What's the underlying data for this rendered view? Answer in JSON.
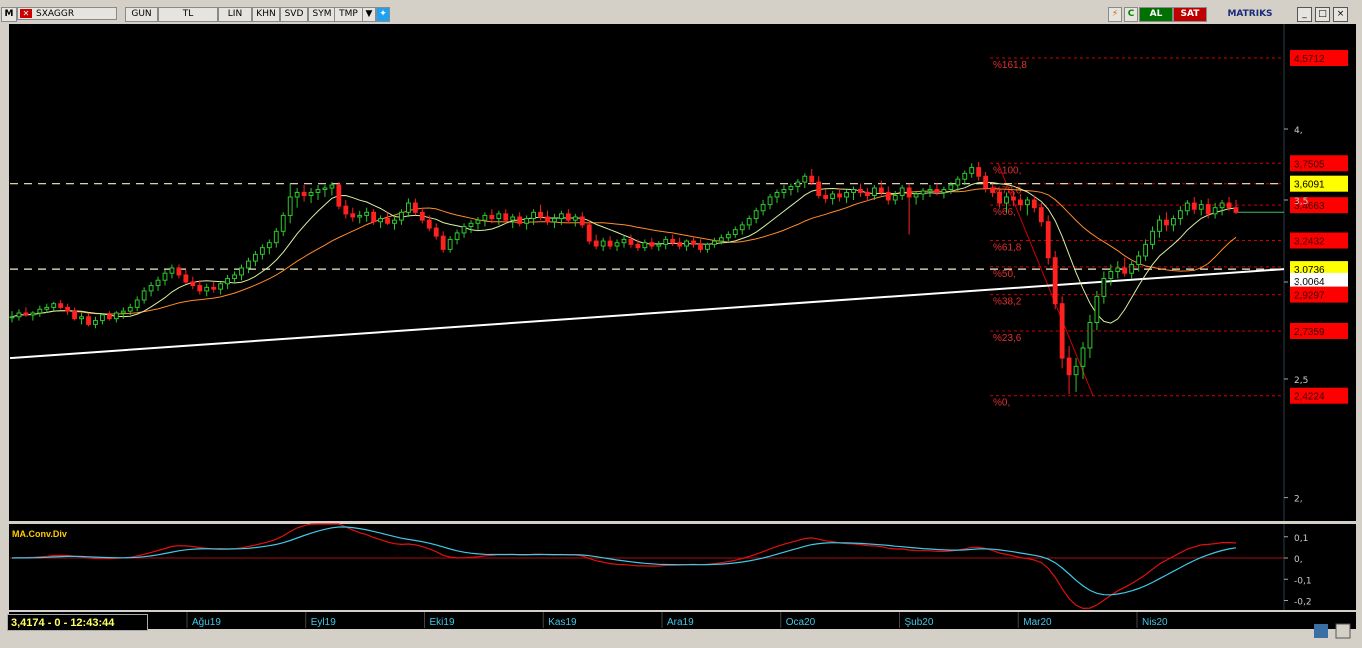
{
  "toolbar": {
    "symbol": "SXAGGR",
    "buttons": [
      "GUN",
      "TL",
      "LIN",
      "KHN",
      "SVD",
      "SYM",
      "TMP"
    ],
    "al_label": "AL",
    "sat_label": "SAT",
    "brand": "MATRIKS",
    "min_label": "_",
    "max_label": "□",
    "close_label": "×"
  },
  "status": "3,4174 - 0 - 12:43:44",
  "chart_data": {
    "type": "candlestick",
    "price_axis": {
      "range": [
        1.76,
        4.7
      ],
      "tick_labels": [
        "4,",
        "3,5",
        "3,",
        "2,5",
        "2,"
      ],
      "tick_values": [
        4.0,
        3.5,
        3.0,
        2.5,
        2.0
      ]
    },
    "time_axis": {
      "labels": [
        "Ağu19",
        "Eyl19",
        "Eki19",
        "Kas19",
        "Ara19",
        "Oca20",
        "Şub20",
        "Mar20",
        "Nis20"
      ]
    },
    "fibonacci": [
      {
        "label": "%161,8",
        "value": 4.5712
      },
      {
        "label": "%100,",
        "value": 3.7505
      },
      {
        "label": "%78,6",
        "value": 3.609
      },
      {
        "label": "%66,",
        "value": 3.4663
      },
      {
        "label": "%61,8",
        "value": 3.2432
      },
      {
        "label": "%50,",
        "value": 3.0864
      },
      {
        "label": "%38,2",
        "value": 2.9297
      },
      {
        "label": "%23,6",
        "value": 2.7359
      },
      {
        "label": "%0,",
        "value": 2.4224
      }
    ],
    "price_flags": [
      {
        "text": "4,5712",
        "value": 4.5712,
        "style": "red"
      },
      {
        "text": "3,7505",
        "value": 3.7505,
        "style": "red"
      },
      {
        "text": "3,6091",
        "value": 3.6091,
        "style": "yellow"
      },
      {
        "text": "3,4663",
        "value": 3.4663,
        "style": "red"
      },
      {
        "text": "3,2432",
        "value": 3.2432,
        "style": "red"
      },
      {
        "text": "3,0736",
        "value": 3.0736,
        "style": "yellow"
      },
      {
        "text": "3,0064",
        "value": 3.0064,
        "style": "white"
      },
      {
        "text": "2,9297",
        "value": 2.9297,
        "style": "red"
      },
      {
        "text": "2,7359",
        "value": 2.7359,
        "style": "red"
      },
      {
        "text": "2,4224",
        "value": 2.4224,
        "style": "red"
      }
    ],
    "horizontal_levels": [
      3.6091,
      3.0736
    ],
    "trendline": {
      "start": 2.6,
      "end": 3.0736
    },
    "indicator": {
      "name": "MA.Conv.Div",
      "tick_labels": [
        "0,1",
        "0,",
        "-0,1",
        "-0,2"
      ],
      "tick_values": [
        0.1,
        0.0,
        -0.1,
        -0.2
      ],
      "range": [
        -0.24,
        0.16
      ]
    },
    "candles": [
      [
        2.81,
        2.84,
        2.78,
        2.81
      ],
      [
        2.81,
        2.85,
        2.79,
        2.83
      ],
      [
        2.83,
        2.86,
        2.81,
        2.82
      ],
      [
        2.82,
        2.84,
        2.79,
        2.83
      ],
      [
        2.83,
        2.87,
        2.81,
        2.85
      ],
      [
        2.85,
        2.88,
        2.83,
        2.86
      ],
      [
        2.86,
        2.89,
        2.84,
        2.88
      ],
      [
        2.88,
        2.9,
        2.85,
        2.86
      ],
      [
        2.86,
        2.88,
        2.82,
        2.84
      ],
      [
        2.84,
        2.86,
        2.79,
        2.8
      ],
      [
        2.8,
        2.83,
        2.77,
        2.81
      ],
      [
        2.81,
        2.83,
        2.76,
        2.77
      ],
      [
        2.77,
        2.81,
        2.75,
        2.79
      ],
      [
        2.79,
        2.83,
        2.77,
        2.82
      ],
      [
        2.82,
        2.84,
        2.79,
        2.8
      ],
      [
        2.8,
        2.84,
        2.78,
        2.83
      ],
      [
        2.83,
        2.86,
        2.8,
        2.84
      ],
      [
        2.84,
        2.88,
        2.82,
        2.86
      ],
      [
        2.86,
        2.92,
        2.84,
        2.9
      ],
      [
        2.9,
        2.97,
        2.88,
        2.95
      ],
      [
        2.95,
        3.0,
        2.92,
        2.98
      ],
      [
        2.98,
        3.03,
        2.95,
        3.01
      ],
      [
        3.01,
        3.07,
        2.98,
        3.05
      ],
      [
        3.05,
        3.1,
        3.02,
        3.08
      ],
      [
        3.08,
        3.1,
        3.02,
        3.04
      ],
      [
        3.04,
        3.07,
        2.99,
        3.0
      ],
      [
        3.0,
        3.03,
        2.96,
        2.98
      ],
      [
        2.98,
        3.01,
        2.93,
        2.95
      ],
      [
        2.95,
        2.99,
        2.92,
        2.97
      ],
      [
        2.97,
        3.0,
        2.94,
        2.96
      ],
      [
        2.96,
        3.0,
        2.93,
        2.99
      ],
      [
        2.99,
        3.04,
        2.96,
        3.02
      ],
      [
        3.02,
        3.06,
        2.99,
        3.04
      ],
      [
        3.04,
        3.1,
        3.01,
        3.08
      ],
      [
        3.08,
        3.14,
        3.05,
        3.12
      ],
      [
        3.12,
        3.18,
        3.09,
        3.16
      ],
      [
        3.16,
        3.22,
        3.13,
        3.2
      ],
      [
        3.2,
        3.25,
        3.16,
        3.23
      ],
      [
        3.23,
        3.32,
        3.2,
        3.3
      ],
      [
        3.3,
        3.42,
        3.27,
        3.4
      ],
      [
        3.4,
        3.61,
        3.35,
        3.52
      ],
      [
        3.52,
        3.58,
        3.45,
        3.55
      ],
      [
        3.55,
        3.6,
        3.49,
        3.53
      ],
      [
        3.53,
        3.58,
        3.48,
        3.55
      ],
      [
        3.55,
        3.6,
        3.5,
        3.57
      ],
      [
        3.57,
        3.6,
        3.52,
        3.58
      ],
      [
        3.58,
        3.62,
        3.53,
        3.6
      ],
      [
        3.6,
        3.62,
        3.44,
        3.46
      ],
      [
        3.46,
        3.5,
        3.38,
        3.41
      ],
      [
        3.41,
        3.45,
        3.36,
        3.39
      ],
      [
        3.39,
        3.43,
        3.35,
        3.4
      ],
      [
        3.4,
        3.45,
        3.36,
        3.42
      ],
      [
        3.42,
        3.44,
        3.34,
        3.36
      ],
      [
        3.36,
        3.4,
        3.32,
        3.38
      ],
      [
        3.38,
        3.42,
        3.34,
        3.35
      ],
      [
        3.35,
        3.4,
        3.31,
        3.37
      ],
      [
        3.37,
        3.44,
        3.34,
        3.42
      ],
      [
        3.42,
        3.51,
        3.39,
        3.48
      ],
      [
        3.48,
        3.51,
        3.4,
        3.42
      ],
      [
        3.42,
        3.45,
        3.35,
        3.37
      ],
      [
        3.37,
        3.4,
        3.3,
        3.32
      ],
      [
        3.32,
        3.35,
        3.25,
        3.27
      ],
      [
        3.27,
        3.3,
        3.17,
        3.19
      ],
      [
        3.19,
        3.27,
        3.17,
        3.25
      ],
      [
        3.25,
        3.31,
        3.22,
        3.29
      ],
      [
        3.29,
        3.35,
        3.26,
        3.33
      ],
      [
        3.33,
        3.37,
        3.29,
        3.35
      ],
      [
        3.35,
        3.39,
        3.31,
        3.37
      ],
      [
        3.37,
        3.42,
        3.33,
        3.4
      ],
      [
        3.4,
        3.44,
        3.35,
        3.38
      ],
      [
        3.38,
        3.43,
        3.34,
        3.41
      ],
      [
        3.41,
        3.44,
        3.35,
        3.37
      ],
      [
        3.37,
        3.41,
        3.32,
        3.39
      ],
      [
        3.39,
        3.42,
        3.33,
        3.35
      ],
      [
        3.35,
        3.4,
        3.31,
        3.38
      ],
      [
        3.38,
        3.44,
        3.34,
        3.42
      ],
      [
        3.42,
        3.47,
        3.37,
        3.39
      ],
      [
        3.39,
        3.43,
        3.34,
        3.36
      ],
      [
        3.36,
        3.41,
        3.32,
        3.38
      ],
      [
        3.38,
        3.43,
        3.34,
        3.41
      ],
      [
        3.41,
        3.44,
        3.35,
        3.37
      ],
      [
        3.37,
        3.41,
        3.33,
        3.39
      ],
      [
        3.39,
        3.42,
        3.32,
        3.34
      ],
      [
        3.34,
        3.37,
        3.22,
        3.24
      ],
      [
        3.24,
        3.28,
        3.19,
        3.21
      ],
      [
        3.21,
        3.26,
        3.18,
        3.24
      ],
      [
        3.24,
        3.27,
        3.19,
        3.21
      ],
      [
        3.21,
        3.25,
        3.18,
        3.23
      ],
      [
        3.23,
        3.27,
        3.2,
        3.25
      ],
      [
        3.25,
        3.28,
        3.2,
        3.22
      ],
      [
        3.22,
        3.25,
        3.18,
        3.2
      ],
      [
        3.2,
        3.25,
        3.18,
        3.23
      ],
      [
        3.23,
        3.26,
        3.19,
        3.21
      ],
      [
        3.21,
        3.24,
        3.18,
        3.22
      ],
      [
        3.22,
        3.27,
        3.19,
        3.25
      ],
      [
        3.25,
        3.28,
        3.21,
        3.23
      ],
      [
        3.23,
        3.26,
        3.19,
        3.21
      ],
      [
        3.21,
        3.25,
        3.18,
        3.24
      ],
      [
        3.24,
        3.27,
        3.2,
        3.22
      ],
      [
        3.22,
        3.25,
        3.17,
        3.19
      ],
      [
        3.19,
        3.23,
        3.17,
        3.22
      ],
      [
        3.22,
        3.26,
        3.2,
        3.24
      ],
      [
        3.24,
        3.28,
        3.22,
        3.26
      ],
      [
        3.26,
        3.3,
        3.24,
        3.28
      ],
      [
        3.28,
        3.33,
        3.26,
        3.31
      ],
      [
        3.31,
        3.36,
        3.28,
        3.34
      ],
      [
        3.34,
        3.4,
        3.31,
        3.38
      ],
      [
        3.38,
        3.45,
        3.35,
        3.43
      ],
      [
        3.43,
        3.5,
        3.4,
        3.47
      ],
      [
        3.47,
        3.54,
        3.44,
        3.52
      ],
      [
        3.52,
        3.57,
        3.48,
        3.55
      ],
      [
        3.55,
        3.6,
        3.51,
        3.57
      ],
      [
        3.57,
        3.61,
        3.53,
        3.59
      ],
      [
        3.59,
        3.64,
        3.55,
        3.62
      ],
      [
        3.62,
        3.68,
        3.58,
        3.66
      ],
      [
        3.66,
        3.71,
        3.6,
        3.62
      ],
      [
        3.62,
        3.66,
        3.51,
        3.53
      ],
      [
        3.53,
        3.57,
        3.48,
        3.51
      ],
      [
        3.51,
        3.56,
        3.47,
        3.54
      ],
      [
        3.54,
        3.58,
        3.49,
        3.52
      ],
      [
        3.52,
        3.57,
        3.48,
        3.55
      ],
      [
        3.55,
        3.59,
        3.5,
        3.57
      ],
      [
        3.57,
        3.61,
        3.52,
        3.55
      ],
      [
        3.55,
        3.58,
        3.49,
        3.53
      ],
      [
        3.53,
        3.6,
        3.5,
        3.58
      ],
      [
        3.58,
        3.63,
        3.53,
        3.55
      ],
      [
        3.55,
        3.59,
        3.47,
        3.5
      ],
      [
        3.5,
        3.56,
        3.47,
        3.53
      ],
      [
        3.53,
        3.6,
        3.5,
        3.58
      ],
      [
        3.58,
        3.61,
        3.28,
        3.52
      ],
      [
        3.52,
        3.56,
        3.47,
        3.54
      ],
      [
        3.54,
        3.58,
        3.5,
        3.56
      ],
      [
        3.56,
        3.6,
        3.52,
        3.57
      ],
      [
        3.57,
        3.61,
        3.53,
        3.55
      ],
      [
        3.55,
        3.59,
        3.51,
        3.57
      ],
      [
        3.57,
        3.62,
        3.54,
        3.6
      ],
      [
        3.6,
        3.66,
        3.56,
        3.64
      ],
      [
        3.64,
        3.7,
        3.6,
        3.68
      ],
      [
        3.68,
        3.75,
        3.65,
        3.72
      ],
      [
        3.72,
        3.76,
        3.63,
        3.66
      ],
      [
        3.66,
        3.69,
        3.55,
        3.58
      ],
      [
        3.58,
        3.61,
        3.52,
        3.55
      ],
      [
        3.55,
        3.58,
        3.45,
        3.48
      ],
      [
        3.48,
        3.55,
        3.42,
        3.52
      ],
      [
        3.52,
        3.56,
        3.46,
        3.5
      ],
      [
        3.5,
        3.54,
        3.43,
        3.47
      ],
      [
        3.47,
        3.52,
        3.4,
        3.5
      ],
      [
        3.5,
        3.53,
        3.42,
        3.45
      ],
      [
        3.45,
        3.48,
        3.33,
        3.36
      ],
      [
        3.36,
        3.4,
        3.1,
        3.14
      ],
      [
        3.14,
        3.18,
        2.85,
        2.88
      ],
      [
        2.88,
        2.92,
        2.55,
        2.6
      ],
      [
        2.6,
        2.66,
        2.43,
        2.52
      ],
      [
        2.52,
        2.6,
        2.44,
        2.56
      ],
      [
        2.56,
        2.68,
        2.5,
        2.65
      ],
      [
        2.65,
        2.82,
        2.6,
        2.78
      ],
      [
        2.78,
        2.95,
        2.74,
        2.92
      ],
      [
        2.92,
        3.06,
        2.88,
        3.02
      ],
      [
        3.02,
        3.1,
        2.98,
        3.06
      ],
      [
        3.06,
        3.12,
        3.02,
        3.08
      ],
      [
        3.08,
        3.14,
        3.03,
        3.05
      ],
      [
        3.05,
        3.12,
        3.02,
        3.1
      ],
      [
        3.1,
        3.18,
        3.06,
        3.15
      ],
      [
        3.15,
        3.25,
        3.12,
        3.22
      ],
      [
        3.22,
        3.33,
        3.19,
        3.3
      ],
      [
        3.3,
        3.4,
        3.26,
        3.37
      ],
      [
        3.37,
        3.42,
        3.3,
        3.34
      ],
      [
        3.34,
        3.4,
        3.3,
        3.38
      ],
      [
        3.38,
        3.46,
        3.34,
        3.43
      ],
      [
        3.43,
        3.5,
        3.4,
        3.48
      ],
      [
        3.48,
        3.52,
        3.41,
        3.44
      ],
      [
        3.44,
        3.5,
        3.4,
        3.47
      ],
      [
        3.47,
        3.51,
        3.38,
        3.41
      ],
      [
        3.41,
        3.48,
        3.38,
        3.45
      ],
      [
        3.45,
        3.5,
        3.4,
        3.48
      ],
      [
        3.48,
        3.52,
        3.43,
        3.45
      ],
      [
        3.45,
        3.5,
        3.41,
        3.42
      ]
    ]
  }
}
